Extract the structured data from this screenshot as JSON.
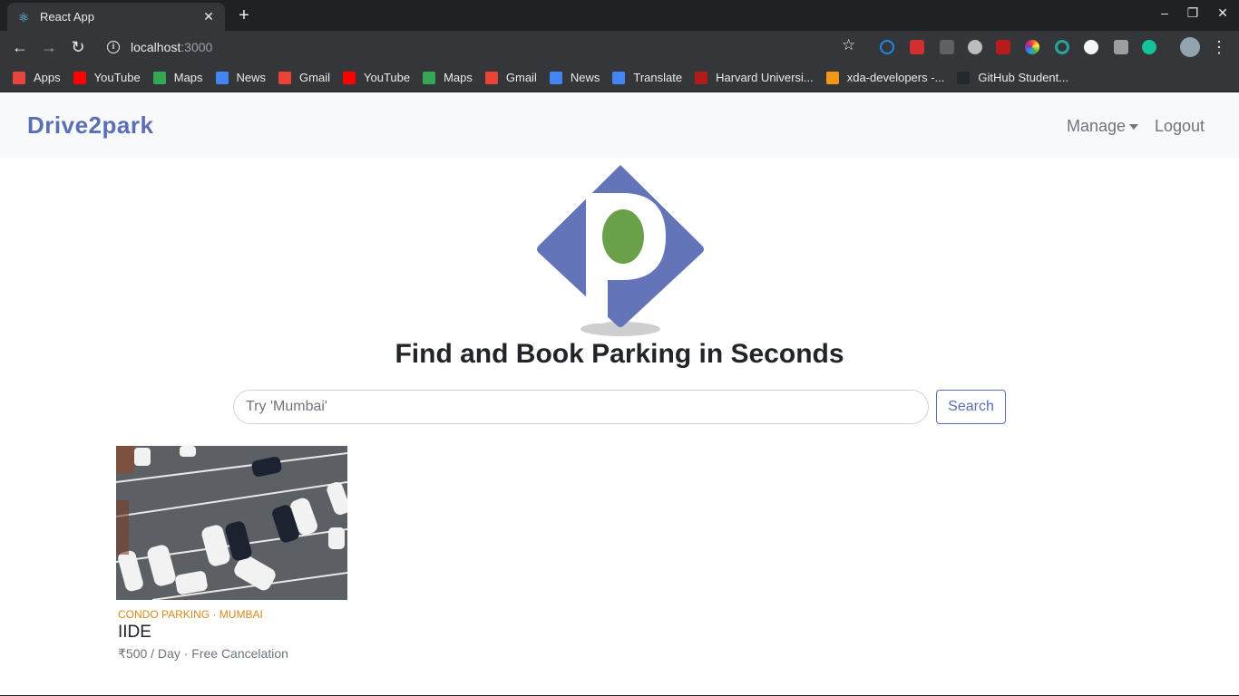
{
  "browser": {
    "tab_title": "React App",
    "tab_close": "✕",
    "new_tab": "+",
    "url_host": "localhost",
    "url_port": ":3000",
    "window_controls": [
      "–",
      "❐",
      "✕"
    ],
    "bookmarks": [
      {
        "label": "Apps",
        "icon": "apps-grid-icon",
        "color": "#e8453c"
      },
      {
        "label": "YouTube",
        "icon": "youtube-icon",
        "color": "#ff0000"
      },
      {
        "label": "Maps",
        "icon": "maps-pin-icon",
        "color": "#34a853"
      },
      {
        "label": "News",
        "icon": "google-news-icon",
        "color": "#4285f4"
      },
      {
        "label": "Gmail",
        "icon": "gmail-icon",
        "color": "#ea4335"
      },
      {
        "label": "YouTube",
        "icon": "youtube-icon",
        "color": "#ff0000"
      },
      {
        "label": "Maps",
        "icon": "maps-pin-icon",
        "color": "#34a853"
      },
      {
        "label": "Gmail",
        "icon": "gmail-icon",
        "color": "#ea4335"
      },
      {
        "label": "News",
        "icon": "google-news-icon",
        "color": "#4285f4"
      },
      {
        "label": "Translate",
        "icon": "translate-icon",
        "color": "#4285f4"
      },
      {
        "label": "Harvard Universi...",
        "icon": "edx-icon",
        "color": "#b31b1b"
      },
      {
        "label": "xda-developers -...",
        "icon": "xda-icon",
        "color": "#f59714"
      },
      {
        "label": "GitHub Student...",
        "icon": "github-icon",
        "color": "#24292e"
      }
    ]
  },
  "navbar": {
    "brand": "Drive2park",
    "manage": "Manage",
    "logout": "Logout"
  },
  "hero": {
    "headline": "Find and Book Parking in Seconds",
    "logo_letter": "p"
  },
  "search": {
    "placeholder": "Try 'Mumbai'",
    "button": "Search"
  },
  "listing": {
    "meta": "CONDO PARKING · MUMBAI",
    "title": "IIDE",
    "price": "₹500 / Day · Free Cancelation"
  },
  "colors": {
    "brand": "#5b6fb3",
    "logo_green": "#6ba04a",
    "accent_orange": "#d48a1a"
  }
}
